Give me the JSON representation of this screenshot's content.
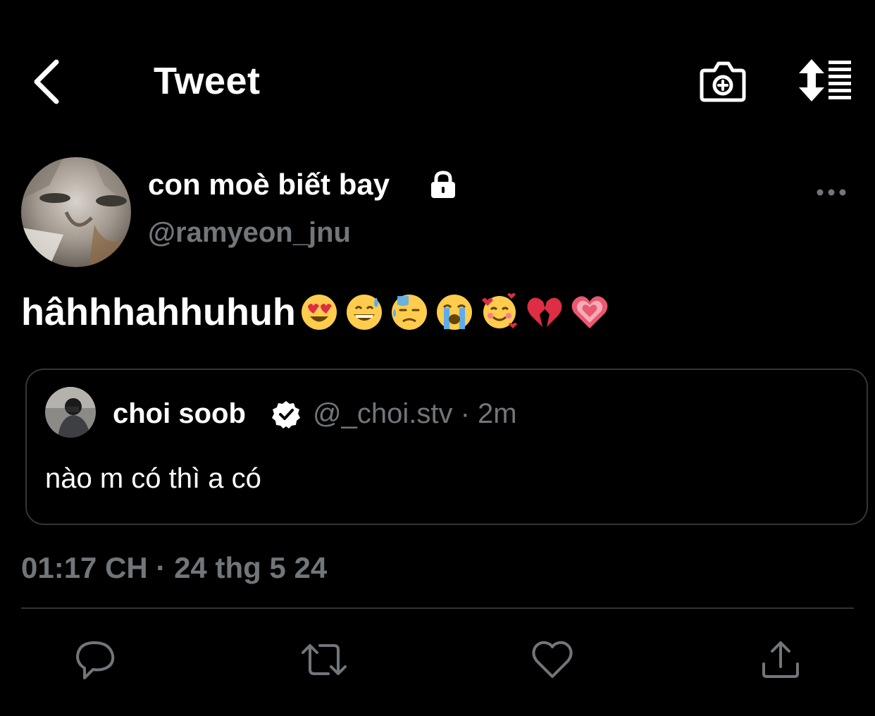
{
  "header": {
    "title": "Tweet",
    "back_icon": "back-arrow-icon",
    "camera_icon": "camera-plus-icon",
    "sort_icon": "sort-list-icon"
  },
  "tweet": {
    "display_name": "con moè biết bay",
    "handle": "@ramyeon_jnu",
    "text": "hâhhhahhuhuh",
    "emojis": [
      "heart-eyes-emoji",
      "grinning-sweat-emoji",
      "downcast-sweat-emoji",
      "loudly-crying-emoji",
      "smiling-hearts-emoji",
      "broken-heart-emoji",
      "growing-heart-emoji"
    ],
    "timestamp": "01:17 CH · 24 thg 5 24",
    "protected_icon": "lock-icon"
  },
  "quote": {
    "display_name": "choi soob",
    "handle": "@_choi.stv",
    "time": "2m",
    "meta": "@_choi.stv · 2m",
    "text": "nào m có thì a có",
    "verified_icon": "verified-badge-icon"
  },
  "actions": [
    "reply-icon",
    "retweet-icon",
    "like-icon",
    "share-icon"
  ],
  "colors": {
    "background": "#000000",
    "text": "#ffffff",
    "secondary": "#71767b",
    "border": "#333639"
  }
}
